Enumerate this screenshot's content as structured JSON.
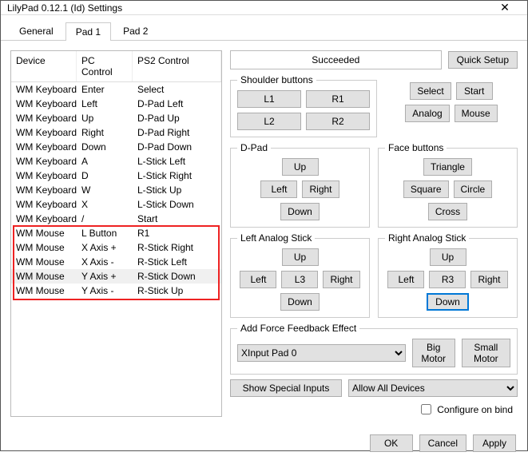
{
  "window": {
    "title": "LilyPad 0.12.1 (Id) Settings"
  },
  "tabs": [
    "General",
    "Pad 1",
    "Pad 2"
  ],
  "active_tab": 1,
  "table": {
    "headers": {
      "device": "Device",
      "pc": "PC Control",
      "ps2": "PS2 Control"
    },
    "rows": [
      {
        "device": "WM Keyboard",
        "pc": "Enter",
        "ps2": "Select"
      },
      {
        "device": "WM Keyboard",
        "pc": "Left",
        "ps2": "D-Pad Left"
      },
      {
        "device": "WM Keyboard",
        "pc": "Up",
        "ps2": "D-Pad Up"
      },
      {
        "device": "WM Keyboard",
        "pc": "Right",
        "ps2": "D-Pad Right"
      },
      {
        "device": "WM Keyboard",
        "pc": "Down",
        "ps2": "D-Pad Down"
      },
      {
        "device": "WM Keyboard",
        "pc": "A",
        "ps2": "L-Stick Left"
      },
      {
        "device": "WM Keyboard",
        "pc": "D",
        "ps2": "L-Stick Right"
      },
      {
        "device": "WM Keyboard",
        "pc": "W",
        "ps2": "L-Stick Up"
      },
      {
        "device": "WM Keyboard",
        "pc": "X",
        "ps2": "L-Stick Down"
      },
      {
        "device": "WM Keyboard",
        "pc": "/",
        "ps2": "Start"
      },
      {
        "device": "WM Mouse",
        "pc": "L Button",
        "ps2": "R1"
      },
      {
        "device": "WM Mouse",
        "pc": "X Axis +",
        "ps2": "R-Stick Right"
      },
      {
        "device": "WM Mouse",
        "pc": "X Axis -",
        "ps2": "R-Stick Left"
      },
      {
        "device": "WM Mouse",
        "pc": "Y Axis +",
        "ps2": "R-Stick Down"
      },
      {
        "device": "WM Mouse",
        "pc": "Y Axis -",
        "ps2": "R-Stick Up"
      }
    ],
    "highlight_row": 13,
    "redbox_start": 10,
    "redbox_end": 14
  },
  "status": "Succeeded",
  "buttons": {
    "quick_setup": "Quick Setup",
    "select": "Select",
    "start": "Start",
    "analog": "Analog",
    "mouse": "Mouse",
    "l1": "L1",
    "r1": "R1",
    "l2": "L2",
    "r2": "R2",
    "up": "Up",
    "down": "Down",
    "left": "Left",
    "right": "Right",
    "triangle": "Triangle",
    "square": "Square",
    "circle": "Circle",
    "cross": "Cross",
    "l3": "L3",
    "r3": "R3",
    "big_motor": "Big Motor",
    "small_motor": "Small Motor",
    "show_special": "Show Special Inputs",
    "ok": "OK",
    "cancel": "Cancel",
    "apply": "Apply"
  },
  "groups": {
    "shoulder": "Shoulder buttons",
    "dpad": "D-Pad",
    "face": "Face buttons",
    "las": "Left Analog Stick",
    "ras": "Right Analog Stick",
    "ffb": "Add Force Feedback Effect"
  },
  "ffb_device": "XInput Pad 0",
  "allow_devices": "Allow All Devices",
  "configure_on_bind": "Configure on bind"
}
